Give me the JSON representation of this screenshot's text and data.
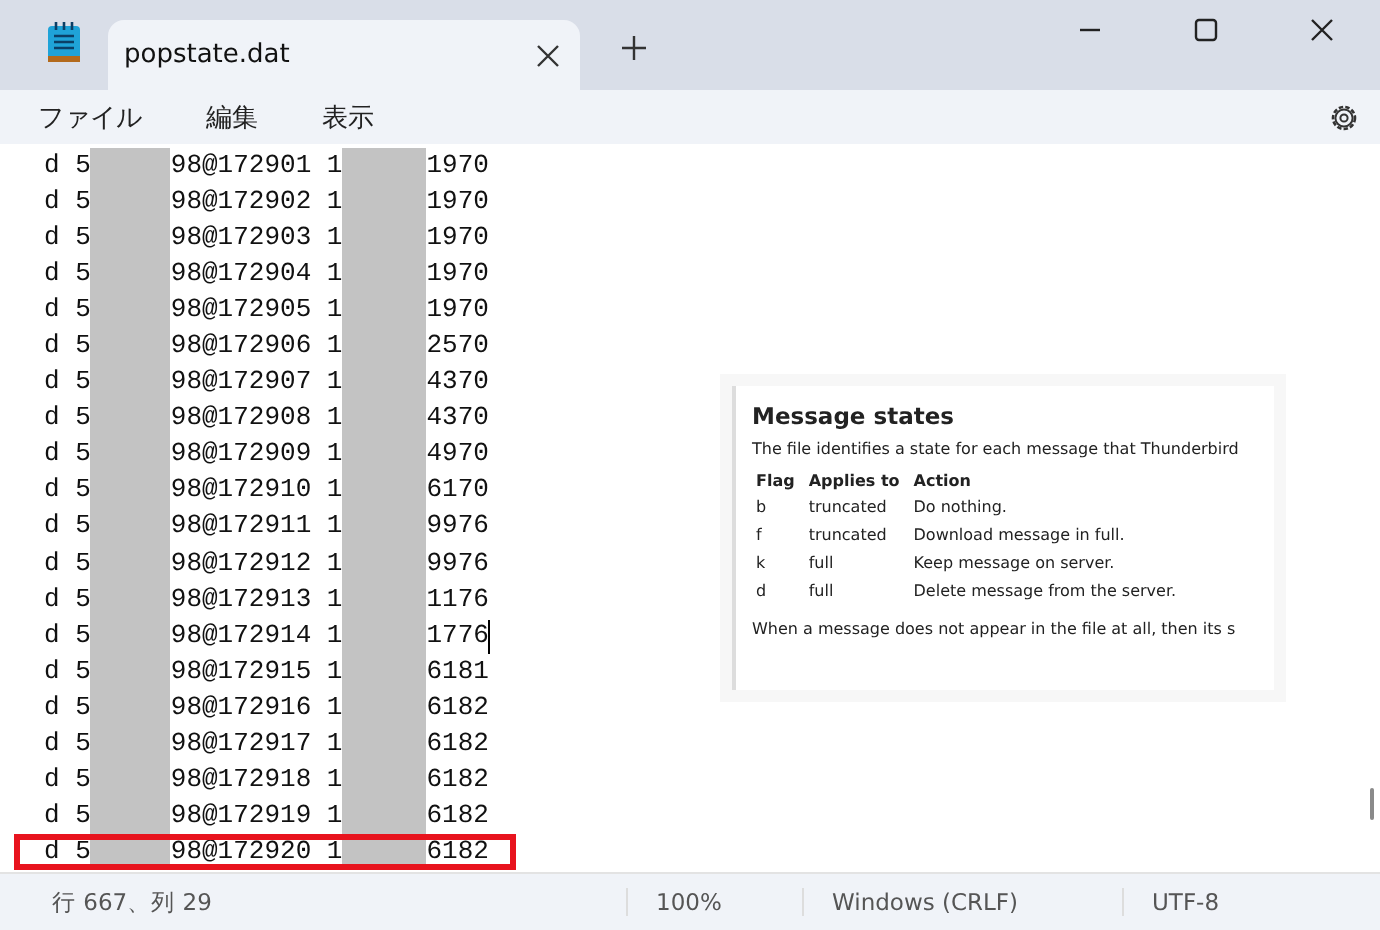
{
  "window": {
    "tab_title": "popstate.dat"
  },
  "menu": [
    "ファイル",
    "編集",
    "表示"
  ],
  "lines": [
    {
      "start": "d 5",
      "middle": "98@172901 1",
      "end": "1970",
      "caret": false,
      "highlighted": false
    },
    {
      "start": "d 5",
      "middle": "98@172902 1",
      "end": "1970",
      "caret": false,
      "highlighted": false
    },
    {
      "start": "d 5",
      "middle": "98@172903 1",
      "end": "1970",
      "caret": false,
      "highlighted": false
    },
    {
      "start": "d 5",
      "middle": "98@172904 1",
      "end": "1970",
      "caret": false,
      "highlighted": false
    },
    {
      "start": "d 5",
      "middle": "98@172905 1",
      "end": "1970",
      "caret": false,
      "highlighted": false
    },
    {
      "start": "d 5",
      "middle": "98@172906 1",
      "end": "2570",
      "caret": false,
      "highlighted": false
    },
    {
      "start": "d 5",
      "middle": "98@172907 1",
      "end": "4370",
      "caret": false,
      "highlighted": false
    },
    {
      "start": "d 5",
      "middle": "98@172908 1",
      "end": "4370",
      "caret": false,
      "highlighted": false
    },
    {
      "start": "d 5",
      "middle": "98@172909 1",
      "end": "4970",
      "caret": false,
      "highlighted": false
    },
    {
      "start": "d 5",
      "middle": "98@172910 1",
      "end": "6170",
      "caret": false,
      "highlighted": false
    },
    {
      "start": "d 5",
      "middle": "98@172911 1",
      "end": "9976",
      "caret": false,
      "highlighted": false
    },
    {
      "start": "d 5",
      "middle": "98@172912 1",
      "end": "9976",
      "caret": false,
      "highlighted": false
    },
    {
      "start": "d 5",
      "middle": "98@172913 1",
      "end": "1176",
      "caret": false,
      "highlighted": false
    },
    {
      "start": "d 5",
      "middle": "98@172914 1",
      "end": "1776",
      "caret": true,
      "highlighted": false
    },
    {
      "start": "d 5",
      "middle": "98@172915 1",
      "end": "6181",
      "caret": false,
      "highlighted": false
    },
    {
      "start": "d 5",
      "middle": "98@172916 1",
      "end": "6182",
      "caret": false,
      "highlighted": false
    },
    {
      "start": "d 5",
      "middle": "98@172917 1",
      "end": "6182",
      "caret": false,
      "highlighted": false
    },
    {
      "start": "d 5",
      "middle": "98@172918 1",
      "end": "6182",
      "caret": false,
      "highlighted": false
    },
    {
      "start": "d 5",
      "middle": "98@172919 1",
      "end": "6182",
      "caret": false,
      "highlighted": false
    },
    {
      "start": "d 5",
      "middle": "98@172920 1",
      "end": "6182",
      "caret": false,
      "highlighted": true
    }
  ],
  "doc": {
    "title": "Message states",
    "intro": "The file identifies a state for each message that Thunderbird",
    "columns": [
      "Flag",
      "Applies to",
      "Action"
    ],
    "rows": [
      [
        "b",
        "truncated",
        "Do nothing."
      ],
      [
        "f",
        "truncated",
        "Download message in full."
      ],
      [
        "k",
        "full",
        "Keep message on server."
      ],
      [
        "d",
        "full",
        "Delete message from the server."
      ]
    ],
    "after": "When a message does not appear in the file at all, then its s"
  },
  "status_bar": {
    "position": "行 667、列 29",
    "zoom": "100%",
    "line_ending": "Windows (CRLF)",
    "encoding": "UTF-8"
  }
}
